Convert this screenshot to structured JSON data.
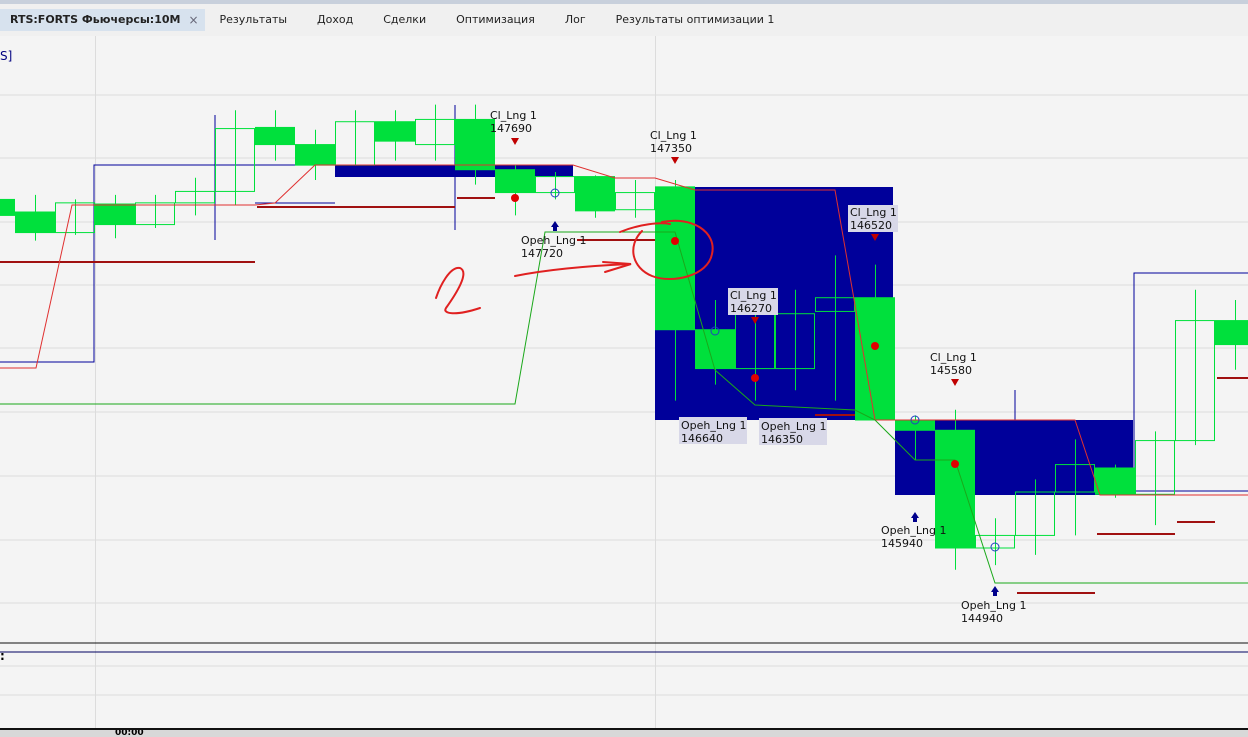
{
  "tabs": [
    {
      "label": "RTS:FORTS Фьючерсы:10M",
      "active": true
    },
    {
      "label": "Результаты"
    },
    {
      "label": "Доход"
    },
    {
      "label": "Сделки"
    },
    {
      "label": "Оптимизация"
    },
    {
      "label": "Лог"
    },
    {
      "label": "Результаты оптимизации 1"
    }
  ],
  "close_icon": "×",
  "legend_fragment": "S]",
  "lower_pane_fragment": ":",
  "time_axis_fragment": "00:00",
  "colors": {
    "candle": "#00e03c",
    "channel": "#00009a",
    "red_line": "#e03030",
    "green_line": "#1aa81a",
    "level": "#a01010"
  },
  "chart_data": {
    "type": "candlestick",
    "instrument": "RTS:FORTS Фьючерсы",
    "timeframe": "10M",
    "candles_ohlc": [
      [
        147180,
        147220,
        147000,
        147040
      ],
      [
        147070,
        147220,
        146820,
        146890
      ],
      [
        146890,
        147180,
        146870,
        147150
      ],
      [
        147140,
        147220,
        146840,
        146960
      ],
      [
        146960,
        147220,
        146930,
        147150
      ],
      [
        147150,
        147370,
        147040,
        147250
      ],
      [
        147250,
        147960,
        147130,
        147800
      ],
      [
        147810,
        147960,
        147520,
        147660
      ],
      [
        147660,
        147790,
        147350,
        147480
      ],
      [
        147480,
        147960,
        147480,
        147860
      ],
      [
        147860,
        147960,
        147520,
        147690
      ],
      [
        147660,
        148010,
        147520,
        147880
      ],
      [
        147880,
        148010,
        147310,
        147440
      ],
      [
        147440,
        147480,
        147040,
        147240
      ],
      [
        147240,
        147420,
        147180,
        147380
      ],
      [
        147380,
        147390,
        147020,
        147080
      ],
      [
        147090,
        147350,
        147020,
        147240
      ],
      [
        147290,
        147350,
        145420,
        146040
      ],
      [
        146040,
        146300,
        145560,
        145700
      ],
      [
        145700,
        146390,
        145420,
        146180
      ],
      [
        145700,
        146390,
        145510,
        146180
      ],
      [
        146200,
        146690,
        145420,
        146320
      ],
      [
        146320,
        146610,
        145250,
        145250
      ],
      [
        145250,
        145290,
        144900,
        145160
      ],
      [
        145160,
        145340,
        143940,
        144130
      ],
      [
        144130,
        144390,
        143980,
        144240
      ],
      [
        144240,
        144730,
        144070,
        144620
      ],
      [
        144620,
        145080,
        144240,
        144860
      ],
      [
        144830,
        144860,
        144570,
        144600
      ],
      [
        144600,
        145150,
        144330,
        145070
      ],
      [
        145070,
        146390,
        145030,
        146120
      ],
      [
        146120,
        146300,
        145690,
        145910
      ]
    ],
    "signals": [
      {
        "name": "Cl_Lng 1",
        "price": "147690",
        "type": "close"
      },
      {
        "name": "Cl_Lng 1",
        "price": "147350",
        "type": "close"
      },
      {
        "name": "Cl_Lng 1",
        "price": "146520",
        "type": "close"
      },
      {
        "name": "Cl_Lng 1",
        "price": "146270",
        "type": "close"
      },
      {
        "name": "Cl_Lng 1",
        "price": "145580",
        "type": "close"
      },
      {
        "name": "Opeh_Lng 1",
        "price": "147720",
        "type": "open"
      },
      {
        "name": "Opeh_Lng 1",
        "price": "146640",
        "type": "open"
      },
      {
        "name": "Opeh_Lng 1",
        "price": "146350",
        "type": "open"
      },
      {
        "name": "Opeh_Lng 1",
        "price": "145940",
        "type": "open"
      },
      {
        "name": "Opeh_Lng 1",
        "price": "144940",
        "type": "open"
      }
    ]
  }
}
